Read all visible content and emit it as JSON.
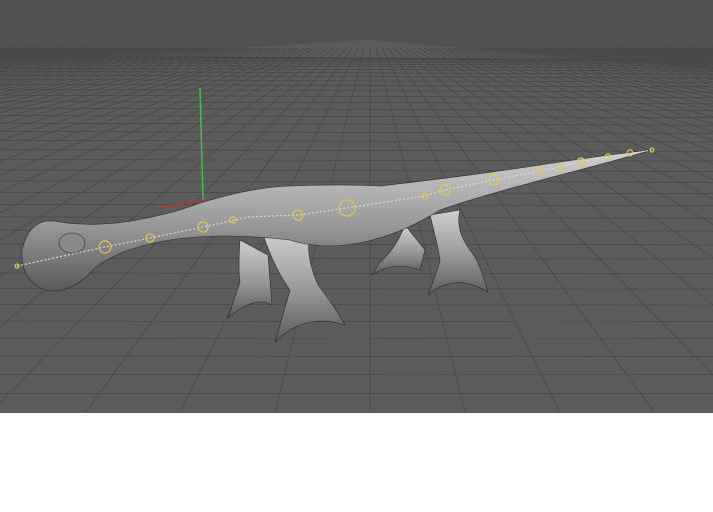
{
  "viewport": {
    "background_color": "#515151",
    "floor_color": "#5c5c5c",
    "grid_line_color": "#474747",
    "model_color": "#a9a9a9",
    "joint_color": "#e0c84a",
    "axis_y_color": "#3fbf4f",
    "axis_x_color": "#c03030"
  }
}
